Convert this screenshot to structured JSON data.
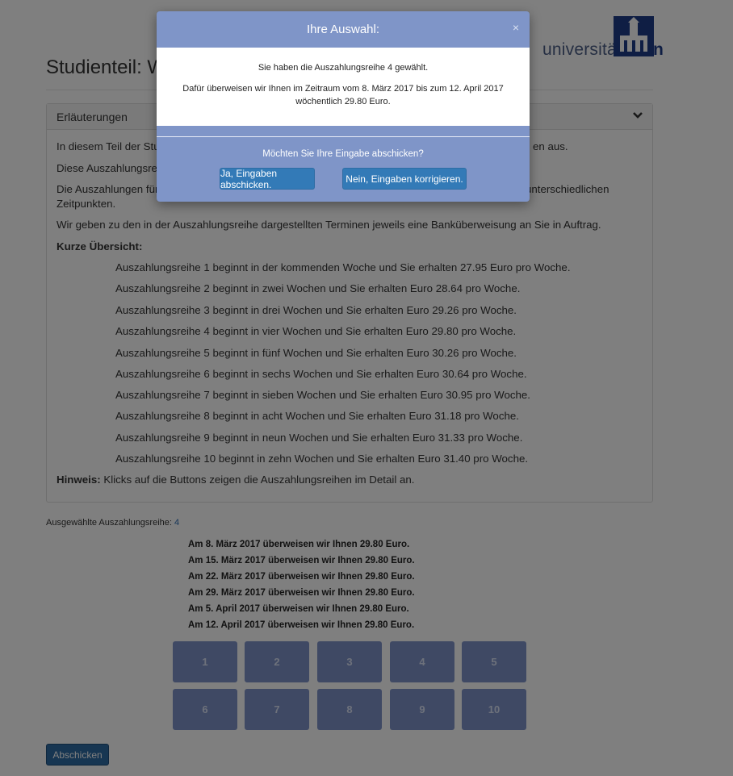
{
  "header": {
    "title": "Studienteil: W",
    "logo_regular": "universität",
    "logo_bold": "bonn"
  },
  "panel": {
    "heading": "Erläuterungen",
    "para1": "In diesem Teil der Stu",
    "para1_end": "en aus.",
    "para2": "Diese Auszahlungsreih",
    "para3a": "Die Auszahlungen für",
    "para3a_end": "unterschiedlichen",
    "para3b": "Zeitpunkten.",
    "para4": "Wir geben zu den in der Auszahlungsreihe dargestellten Terminen jeweils eine Banküberweisung an Sie in Auftrag.",
    "overview_heading": "Kurze Übersicht:",
    "overview": [
      "Auszahlungsreihe 1 beginnt in der kommenden Woche und Sie erhalten 27.95 Euro pro Woche.",
      "Auszahlungsreihe 2 beginnt in zwei Wochen und Sie erhalten Euro 28.64 pro Woche.",
      "Auszahlungsreihe 3 beginnt in drei Wochen und Sie erhalten Euro 29.26 pro Woche.",
      "Auszahlungsreihe 4 beginnt in vier Wochen und Sie erhalten Euro 29.80 pro Woche.",
      "Auszahlungsreihe 5 beginnt in fünf Wochen und Sie erhalten Euro 30.26 pro Woche.",
      "Auszahlungsreihe 6 beginnt in sechs Wochen und Sie erhalten Euro 30.64 pro Woche.",
      "Auszahlungsreihe 7 beginnt in sieben Wochen und Sie erhalten Euro 30.95 pro Woche.",
      "Auszahlungsreihe 8 beginnt in acht Wochen und Sie erhalten Euro 31.18 pro Woche.",
      "Auszahlungsreihe 9 beginnt in neun Wochen und Sie erhalten Euro 31.33 pro Woche.",
      "Auszahlungsreihe 10 beginnt in zehn Wochen und Sie erhalten Euro 31.40 pro Woche."
    ],
    "hint_label": "Hinweis:",
    "hint_text": " Klicks auf die Buttons zeigen die Auszahlungsreihen im Detail an."
  },
  "selection": {
    "label": "Ausgewählte Auszahlungsreihe: ",
    "value": "4",
    "dates": [
      "Am 8. März 2017 überweisen wir Ihnen 29.80 Euro.",
      "Am 15. März 2017 überweisen wir Ihnen 29.80 Euro.",
      "Am 22. März 2017 überweisen wir Ihnen 29.80 Euro.",
      "Am 29. März 2017 überweisen wir Ihnen 29.80 Euro.",
      "Am 5. April 2017 überweisen wir Ihnen 29.80 Euro.",
      "Am 12. April 2017 überweisen wir Ihnen 29.80 Euro."
    ]
  },
  "tiles": [
    "1",
    "2",
    "3",
    "4",
    "5",
    "6",
    "7",
    "8",
    "9",
    "10"
  ],
  "submit_label": "Abschicken",
  "modal": {
    "title": "Ihre Auswahl:",
    "close": "×",
    "line1": "Sie haben die Auszahlungsreihe 4 gewählt.",
    "line2": "Dafür überweisen wir Ihnen im Zeitraum vom 8. März 2017 bis zum 12. April 2017",
    "line3": "wöchentlich 29.80 Euro.",
    "question": "Möchten Sie Ihre Eingabe abschicken?",
    "yes_label": "Ja, Eingaben abschicken.",
    "no_label": "Nein, Eingaben korrigieren."
  },
  "colors": {
    "modal_bg": "#7f95c8",
    "primary_button": "#337ab7",
    "tile_bg": "#7f93c9"
  }
}
